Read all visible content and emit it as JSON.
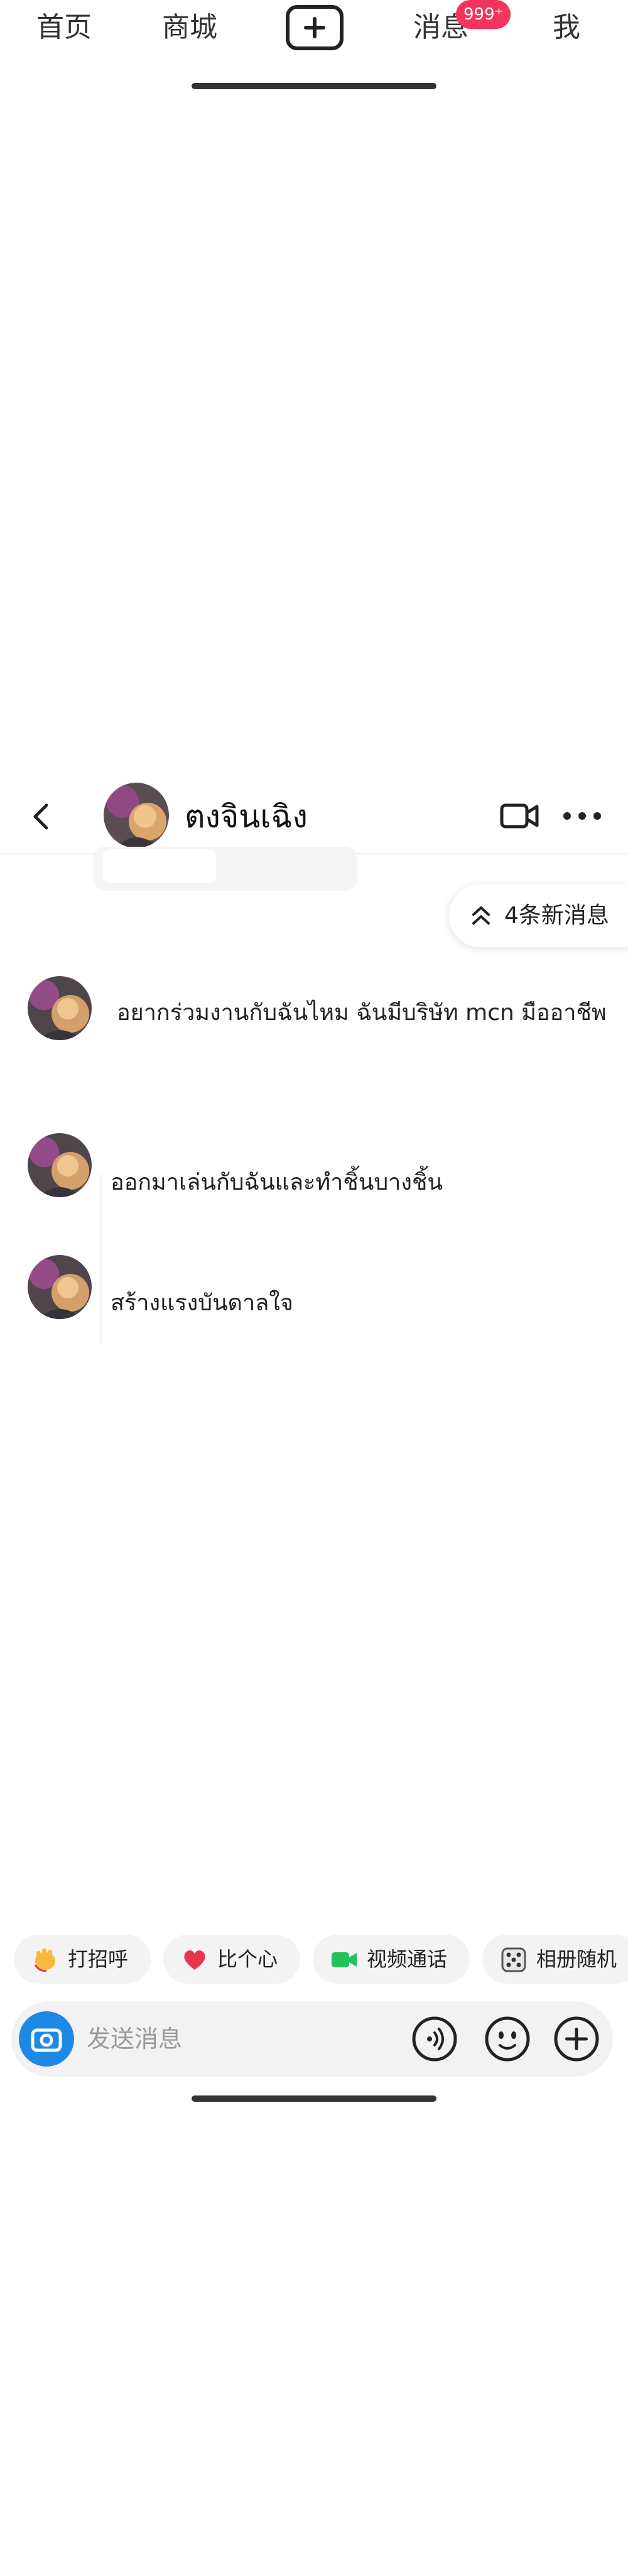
{
  "top_tabs": {
    "home": "首页",
    "mall": "商城",
    "messages": "消息",
    "messages_badge": "999⁺",
    "me": "我"
  },
  "chat": {
    "contact_name": "ตงจินเฉิง",
    "new_messages_pill": "4条新消息",
    "messages": [
      {
        "text": "อยากร่วมงานกับฉันไหม ฉันมีบริษัท mcn มืออาชีพ"
      },
      {
        "text": "ออกมาเล่นกับฉันและทำชิ้นบางชิ้น"
      },
      {
        "text": "สร้างแรงบันดาลใจ"
      }
    ]
  },
  "quick_actions": [
    {
      "label": "打招呼",
      "icon": "wave-hand-icon"
    },
    {
      "label": "比个心",
      "icon": "heart-icon"
    },
    {
      "label": "视频通话",
      "icon": "video-camera-icon"
    },
    {
      "label": "相册随机",
      "icon": "dice-icon"
    }
  ],
  "composer": {
    "placeholder": "发送消息"
  },
  "colors": {
    "badge": "#f4345b",
    "camera_button": "#1e88e5",
    "heart": "#e8374a",
    "video_green": "#22c35a"
  }
}
